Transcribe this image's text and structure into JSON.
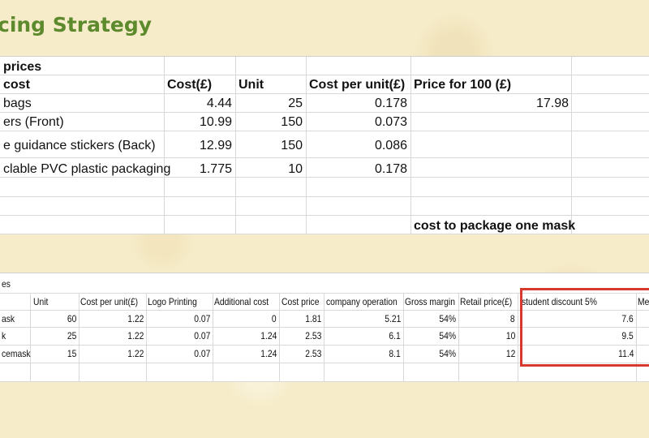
{
  "page": {
    "title": "cing Strategy"
  },
  "top_table": {
    "caption": "prices",
    "headers": [
      "cost",
      "Cost(£)",
      "Unit",
      "Cost per unit(£)",
      "Price for 100 (£)"
    ],
    "rows": [
      [
        "bags",
        "4.44",
        "25",
        "0.178",
        "17.98"
      ],
      [
        "ers (Front)",
        "10.99",
        "150",
        "0.073",
        ""
      ],
      [
        "e guidance stickers (Back)",
        "12.99",
        "150",
        "0.086",
        ""
      ],
      [
        "clable PVC plastic packaging",
        "1.775",
        "10",
        "0.178",
        ""
      ]
    ],
    "footer_label": "cost to package one mask"
  },
  "bottom_table": {
    "caption": "es",
    "headers": [
      "",
      "Unit",
      "Cost per unit(£)",
      "Logo Printing",
      "Additional cost",
      "Cost price",
      "company operation",
      "Gross margin",
      "Retail price(£)",
      "student discount 5%",
      "Me"
    ],
    "rows": [
      [
        "ask",
        "60",
        "1.22",
        "0.07",
        "0",
        "1.81",
        "5.21",
        "54%",
        "8",
        "7.6",
        ""
      ],
      [
        "k",
        "25",
        "1.22",
        "0.07",
        "1.24",
        "2.53",
        "6.1",
        "54%",
        "10",
        "9.5",
        ""
      ],
      [
        "cemask",
        "15",
        "1.22",
        "0.07",
        "1.24",
        "2.53",
        "8.1",
        "54%",
        "12",
        "11.4",
        ""
      ]
    ]
  },
  "colors": {
    "title": "#5e8a2e",
    "highlight_border": "#d63a2f"
  }
}
